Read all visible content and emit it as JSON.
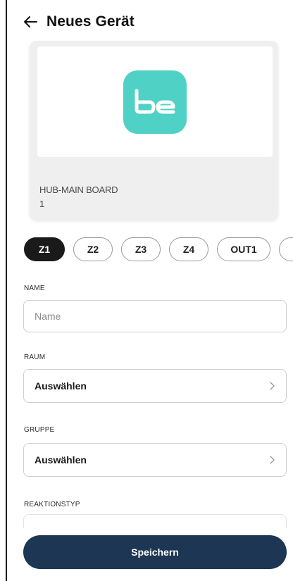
{
  "header": {
    "title": "Neues Gerät",
    "back_icon": "arrow-left-icon"
  },
  "device": {
    "name": "HUB-MAIN BOARD",
    "number": "1",
    "logo_text": "be",
    "logo_color": "#4fd1c5"
  },
  "zones": {
    "items": [
      {
        "label": "Z1",
        "active": true
      },
      {
        "label": "Z2",
        "active": false
      },
      {
        "label": "Z3",
        "active": false
      },
      {
        "label": "Z4",
        "active": false
      },
      {
        "label": "OUT1",
        "active": false
      }
    ]
  },
  "form": {
    "name": {
      "label": "NAME",
      "placeholder": "Name",
      "value": ""
    },
    "room": {
      "label": "RAUM",
      "value": "Auswählen"
    },
    "group": {
      "label": "GRUPPE",
      "value": "Auswählen"
    },
    "reaction_type": {
      "label": "REAKTIONSTYP"
    }
  },
  "actions": {
    "save_label": "Speichern"
  },
  "colors": {
    "primary_button": "#1d3653",
    "chip_active": "#1a1a1a",
    "logo": "#4fd1c5"
  }
}
